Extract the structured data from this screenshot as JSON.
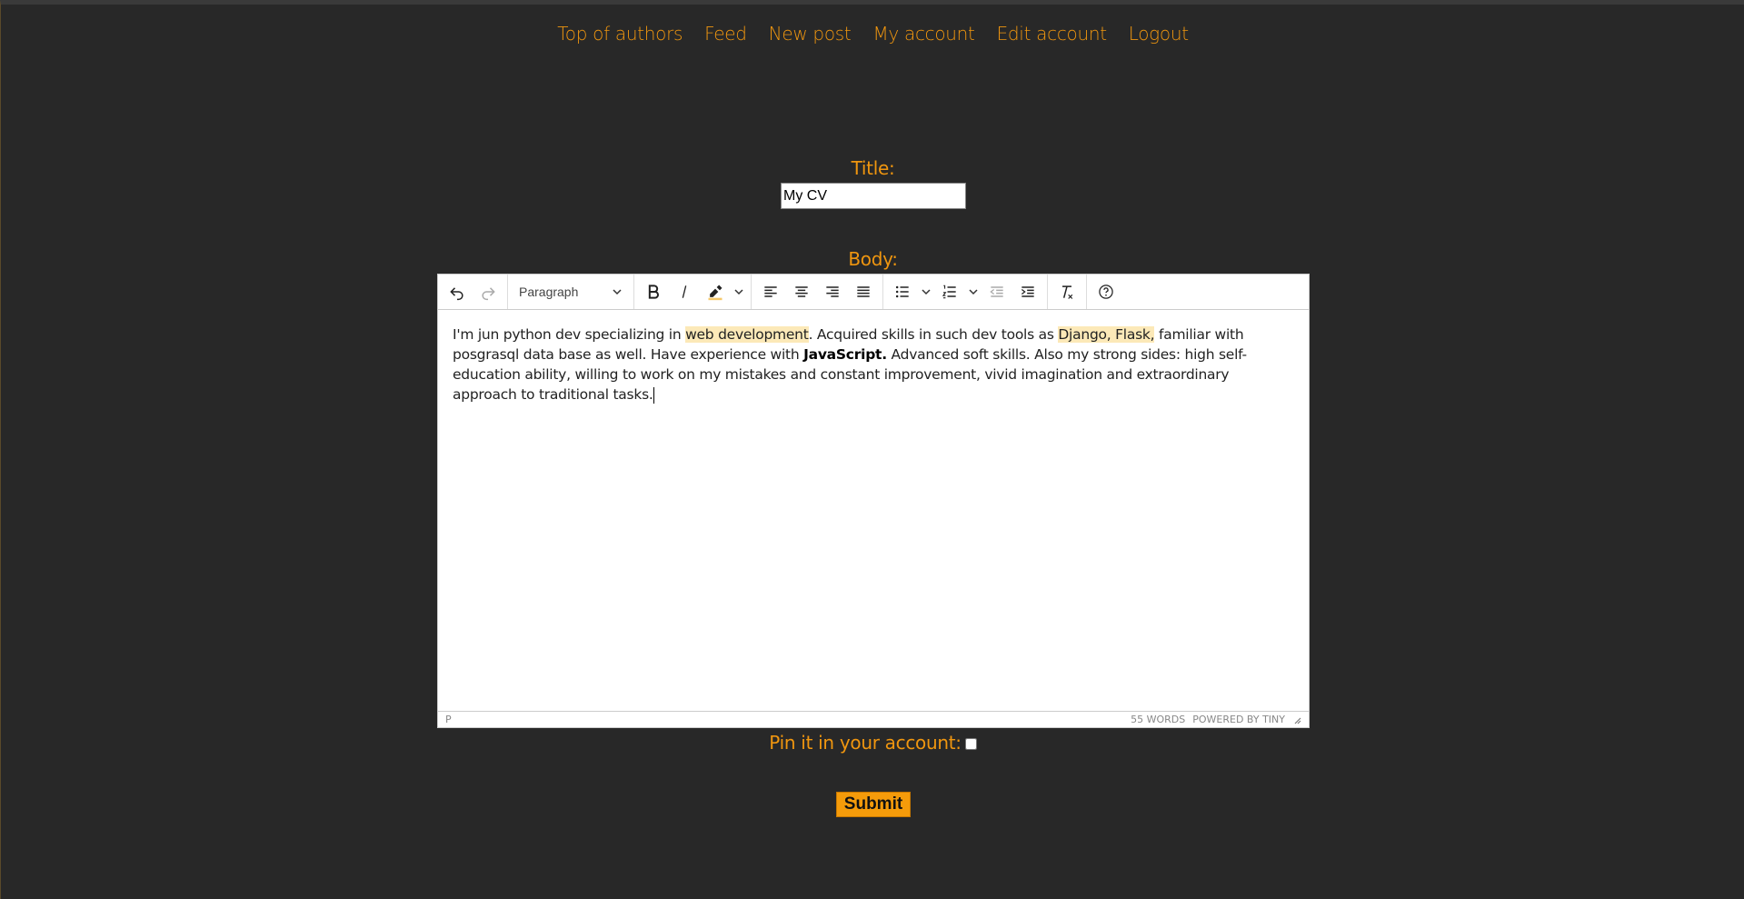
{
  "nav": {
    "items": [
      "Top of authors",
      "Feed",
      "New post",
      "My account",
      "Edit account",
      "Logout"
    ]
  },
  "form": {
    "title_label": "Title:",
    "title_value": "My CV",
    "body_label": "Body:",
    "pin_label": "Pin it in your account:",
    "submit_label": "Submit"
  },
  "editor": {
    "block_format": "Paragraph",
    "content": {
      "t1": "I'm jun python dev specializing in ",
      "h1": "web development",
      "t2": ". Acquired skills in such dev tools as ",
      "h2": "Django, Flask,",
      "t3": " familiar with posgrasql data base as well. Have experience with ",
      "b1": "JavaScript.",
      "t4": " Advanced soft skills. Also my strong sides: high self-education ability, willing to work on my mistakes and constant improvement, vivid imagination and extraordinary approach to traditional tasks."
    },
    "status_path": "P",
    "word_count": "55 WORDS",
    "powered_by": "POWERED BY TINY"
  },
  "colors": {
    "accent": "#f0960f",
    "background": "#282828",
    "highlight": "#fce9b8"
  }
}
